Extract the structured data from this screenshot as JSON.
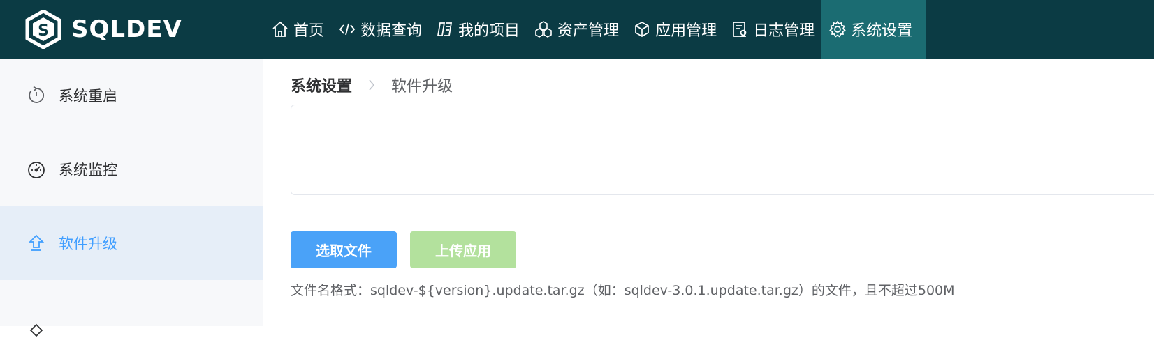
{
  "header": {
    "logo_text": "SQLDEV",
    "nav": [
      {
        "label": "首页",
        "icon": "home-icon"
      },
      {
        "label": "数据查询",
        "icon": "code-icon"
      },
      {
        "label": "我的项目",
        "icon": "project-icon"
      },
      {
        "label": "资产管理",
        "icon": "hexagons-icon"
      },
      {
        "label": "应用管理",
        "icon": "cube-icon"
      },
      {
        "label": "日志管理",
        "icon": "log-icon"
      },
      {
        "label": "系统设置",
        "icon": "gear-icon",
        "active": true
      }
    ]
  },
  "sidebar": {
    "items": [
      {
        "label": "系统重启",
        "icon": "restart-icon"
      },
      {
        "label": "系统监控",
        "icon": "dashboard-icon"
      },
      {
        "label": "软件升级",
        "icon": "upload-arrow-icon",
        "active": true
      }
    ]
  },
  "breadcrumb": {
    "root": "系统设置",
    "current": "软件升级"
  },
  "upload": {
    "select_label": "选取文件",
    "upload_label": "上传应用",
    "hint": "文件名格式：sqldev-${version}.update.tar.gz（如：sqldev-3.0.1.update.tar.gz）的文件，且不超过500M"
  },
  "colors": {
    "header_bg": "#0b3b44",
    "active_nav_bg": "#1b6c72",
    "primary": "#4aa2f8",
    "disabled_success": "#b3e19d",
    "sidebar_active_bg": "#e6eef8",
    "sidebar_active_text": "#409eff"
  }
}
